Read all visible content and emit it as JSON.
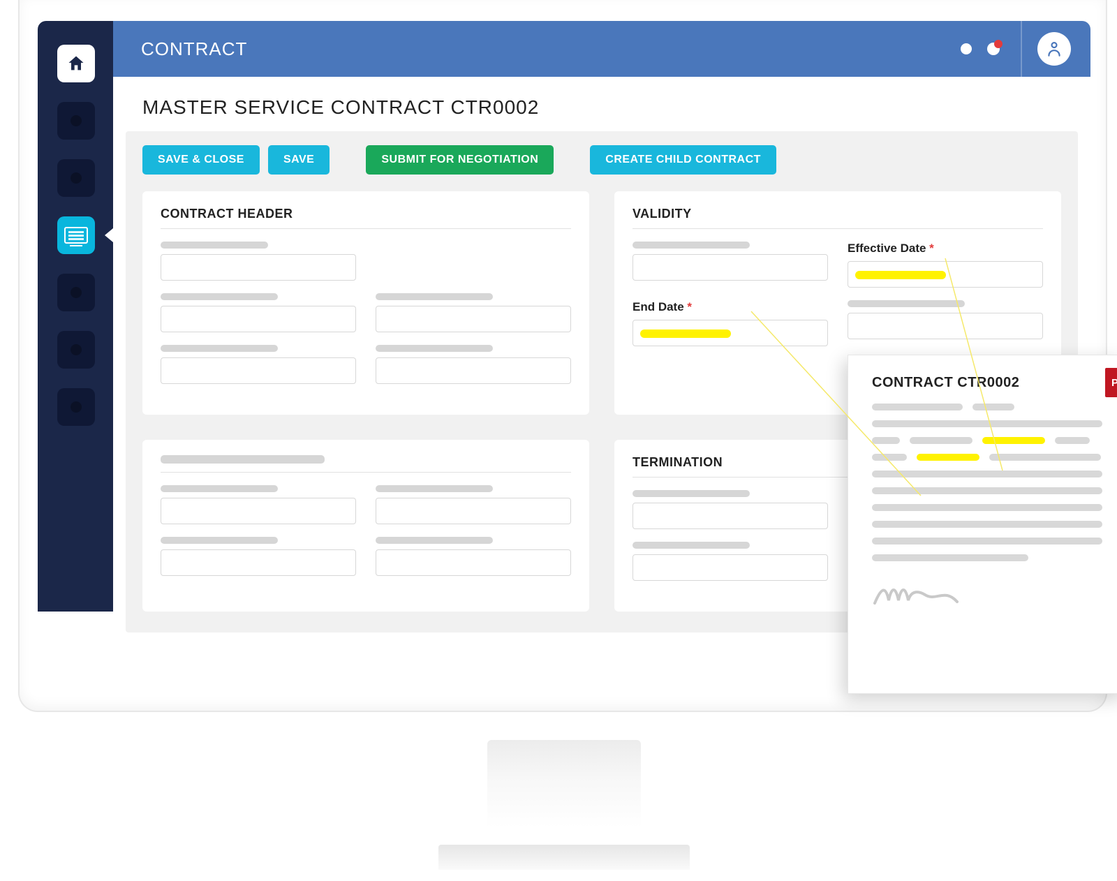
{
  "header": {
    "app_title": "CONTRACT"
  },
  "page": {
    "title": "MASTER SERVICE CONTRACT CTR0002"
  },
  "actions": {
    "save_close": "SAVE & CLOSE",
    "save": "SAVE",
    "submit_negotiation": "SUBMIT FOR NEGOTIATION",
    "create_child": "CREATE CHILD CONTRACT"
  },
  "panels": {
    "contract_header": {
      "title": "CONTRACT HEADER"
    },
    "validity": {
      "title": "VALIDITY",
      "effective_date_label": "Effective Date",
      "end_date_label": "End Date"
    },
    "termination": {
      "title": "TERMINATION"
    }
  },
  "pdf": {
    "badge": "PDF",
    "title": "CONTRACT CTR0002"
  }
}
